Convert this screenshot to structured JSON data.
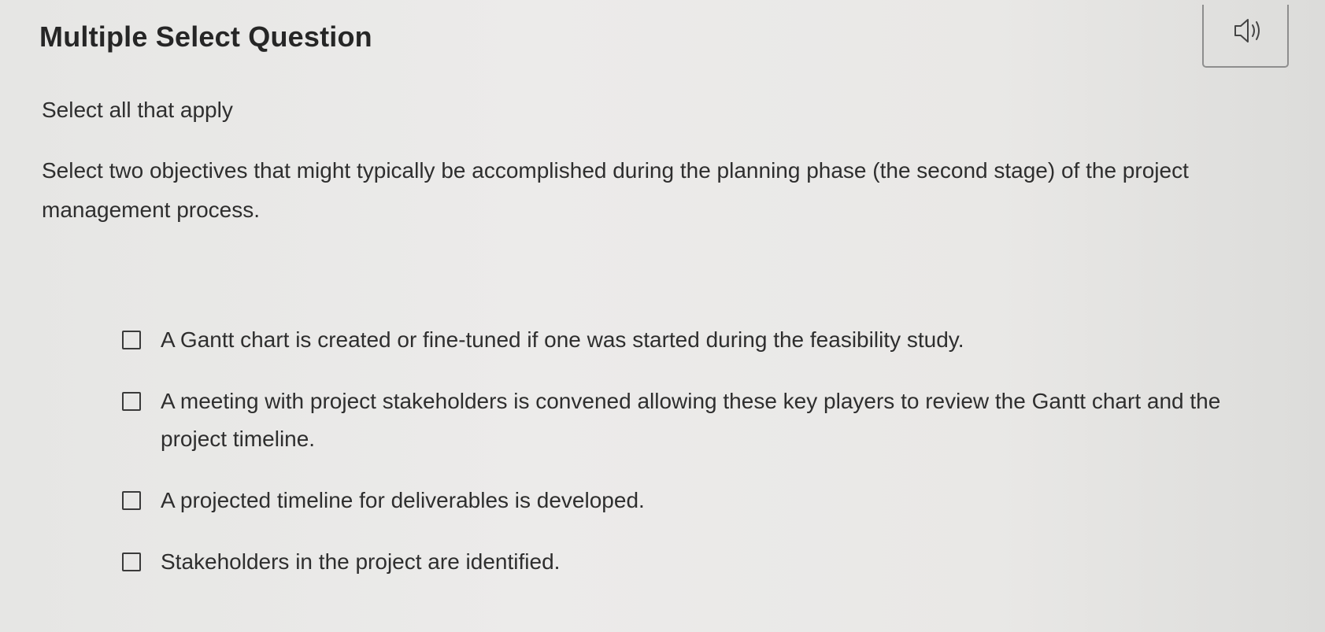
{
  "question": {
    "type_label": "Multiple Select Question",
    "instructions": "Select all that apply",
    "prompt": "Select two objectives that might typically be accomplished during the planning phase (the second stage) of the project management process."
  },
  "audio_button": {
    "icon": "speaker-icon"
  },
  "options": [
    {
      "label": "A Gantt chart is created or fine-tuned if one was started during the feasibility study.",
      "checked": false
    },
    {
      "label": "A meeting with project stakeholders is convened allowing these key players to review the Gantt chart and the project timeline.",
      "checked": false
    },
    {
      "label": "A projected timeline for deliverables is developed.",
      "checked": false
    },
    {
      "label": "Stakeholders in the project are identified.",
      "checked": false
    }
  ]
}
